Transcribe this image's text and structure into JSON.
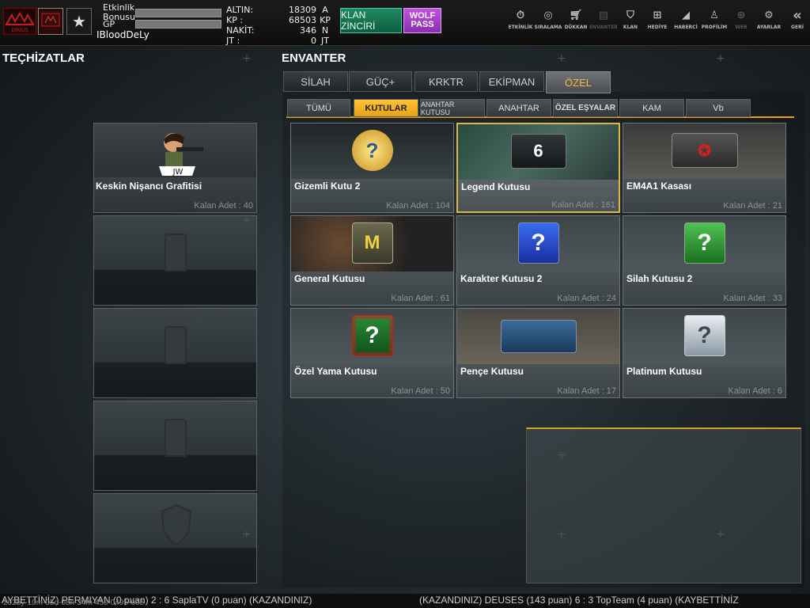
{
  "player": {
    "name": "IBloodDeLy",
    "event_bonus_label": "Etkinlik Bonusu",
    "gp_label": "GP"
  },
  "currency": [
    {
      "label": "ALTIN:",
      "value": "18309",
      "unit": "A"
    },
    {
      "label": "KP :",
      "value": "68503",
      "unit": "KP"
    },
    {
      "label": "NAKİT:",
      "value": "346",
      "unit": "N"
    },
    {
      "label": "JT :",
      "value": "0",
      "unit": "JT"
    }
  ],
  "buttons": {
    "klan": "KLAN ZİNCİRİ",
    "wolf": "WOLF PASS"
  },
  "nav": [
    {
      "label": "ETKİNLİK",
      "icon": "timer-icon"
    },
    {
      "label": "SIRALAMA",
      "icon": "medal-icon"
    },
    {
      "label": "DÜKKAN",
      "icon": "cart-icon"
    },
    {
      "label": "ENVANTER",
      "icon": "inventory-icon"
    },
    {
      "label": "KLAN",
      "icon": "shield-icon"
    },
    {
      "label": "HEDİYE",
      "icon": "gift-icon"
    },
    {
      "label": "HABERCİ",
      "icon": "megaphone-icon"
    },
    {
      "label": "PROFİLİM",
      "icon": "profile-icon"
    },
    {
      "label": "WEB",
      "icon": "globe-icon"
    },
    {
      "label": "AYARLAR",
      "icon": "gear-icon"
    },
    {
      "label": "GERİ",
      "icon": "back-icon"
    }
  ],
  "left": {
    "title": "TEÇHİZATLAR",
    "slot1": {
      "name": "Keskin Nişancı Grafitisi",
      "count": "Kalan Adet : 40"
    }
  },
  "inventory": {
    "title": "ENVANTER",
    "tabs": [
      "SİLAH",
      "GÜÇ+",
      "KRKTR",
      "EKİPMAN",
      "ÖZEL"
    ],
    "subtabs": [
      "TÜMÜ",
      "KUTULAR",
      "ANAHTAR KUTUSU",
      "ANAHTAR",
      "ÖZEL EŞYALAR",
      "KAM",
      "Vb"
    ],
    "items": [
      {
        "name": "Gizemli Kutu 2",
        "count": "Kalan Adet : 104"
      },
      {
        "name": "Legend Kutusu",
        "count": "Kalan Adet : 161"
      },
      {
        "name": "EM4A1 Kasası",
        "count": "Kalan Adet : 21"
      },
      {
        "name": "General Kutusu",
        "count": "Kalan Adet : 61"
      },
      {
        "name": "Karakter Kutusu 2",
        "count": "Kalan Adet : 24"
      },
      {
        "name": "Silah Kutusu 2",
        "count": "Kalan Adet : 33"
      },
      {
        "name": "Özel Yama Kutusu",
        "count": "Kalan Adet : 50"
      },
      {
        "name": "Pençe Kutusu",
        "count": "Kalan Adet : 17"
      },
      {
        "name": "Platinum Kutusu",
        "count": "Kalan Adet : 6"
      }
    ]
  },
  "ticker": {
    "left": "AYBETTİNİZ) PERMIYAN (0 puan) 2 : 6 SaplaTV (0 puan) (KAZANDINIZ)",
    "right": "(KAZANDINIZ) DEUSES (143 puan) 6 : 3 TopTeam (4 puan) (KAYBETTİNİZ",
    "timestamp": "2025y-10m-05d-08h-34m-45s-0495-665"
  },
  "colors": {
    "accent": "#ffb33a",
    "klan": "#1e8a62",
    "wolf": "#b048d8"
  }
}
